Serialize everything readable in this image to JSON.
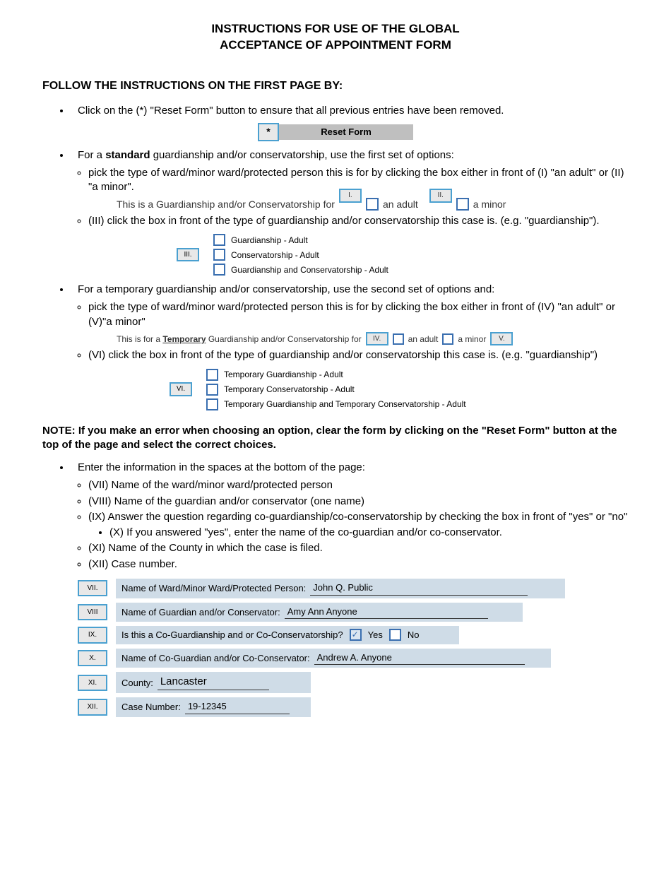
{
  "title_line1": "INSTRUCTIONS FOR USE OF THE GLOBAL",
  "title_line2": "ACCEPTANCE OF APPOINTMENT FORM",
  "section_head": "FOLLOW THE INSTRUCTIONS ON THE FIRST PAGE BY:",
  "bullet_reset": "Click on the (*) \"Reset Form\" button to ensure that all previous entries have been removed.",
  "reset_star": "*",
  "reset_label": "Reset Form",
  "bullet_standard_lead": "For a ",
  "bullet_standard_bold": "standard",
  "bullet_standard_tail": " guardianship and/or conservatorship, use the first set of options:",
  "sub_pick_standard": "pick the type of ward/minor ward/protected person this is for by clicking the box either in front of (I) \"an adult\" or (II) \"a minor\".",
  "line_standard_prefix": "This is a Guardianship and/or Conservatorship for",
  "label_adult": "an adult",
  "label_minor": "a minor",
  "callout_I": "I.",
  "callout_II": "II.",
  "sub_III": "(III) click the box in front of the type of guardianship and/or conservatorship this case is. (e.g. \"guardianship\").",
  "callout_III": "III.",
  "opt_g_adult": "Guardianship - Adult",
  "opt_c_adult": "Conservatorship - Adult",
  "opt_gc_adult": "Guardianship and Conservatorship - Adult",
  "bullet_temp": "For a temporary guardianship and/or conservatorship, use the second set of options and:",
  "sub_pick_temp": "pick the type of ward/minor ward/protected person this is for by clicking the box either in front of (IV) \"an adult\" or (V)\"a minor\"",
  "line_temp_prefix": "This is for a ",
  "line_temp_word": "Temporary",
  "line_temp_suffix": " Guardianship and/or Conservatorship for",
  "callout_IV": "IV.",
  "callout_V": "V.",
  "sub_VI": "(VI) click the box in front of the type of guardianship and/or conservatorship this case is. (e.g. \"guardianship\")",
  "callout_VI": "VI.",
  "opt_tg_adult": "Temporary Guardianship - Adult",
  "opt_tc_adult": "Temporary Conservatorship - Adult",
  "opt_tgc_adult": "Temporary Guardianship and Temporary Conservatorship - Adult",
  "note_text": "NOTE:  If you make an error when choosing an option, clear the form by clicking on the \"Reset Form\" button at the top of the page and select the correct choices.",
  "bullet_enter": "Enter the information in the spaces at the bottom of the page:",
  "sub_VII": "(VII) Name of the ward/minor ward/protected person",
  "sub_VIII": "(VIII) Name of the guardian and/or conservator (one name)",
  "sub_IX": "(IX) Answer the question regarding co-guardianship/co-conservatorship by checking the box in front of \"yes\" or \"no\"",
  "sub_X": "(X) If you answered \"yes\", enter the name of the co-guardian and/or co-conservator.",
  "sub_XI": "(XI) Name of the County in which the case is filed.",
  "sub_XII": "(XII) Case number.",
  "fields": {
    "VII": {
      "num": "VII.",
      "label": "Name of Ward/Minor Ward/Protected Person:",
      "value": "John Q. Public"
    },
    "VIII": {
      "num": "VIII",
      "label": "Name of Guardian and/or Conservator:",
      "value": "Amy Ann Anyone"
    },
    "IX": {
      "num": "IX.",
      "label": "Is this a Co-Guardianship and or Co-Conservatorship?",
      "yes": "Yes",
      "no": "No"
    },
    "X": {
      "num": "X.",
      "label": "Name of Co-Guardian and/or Co-Conservator:",
      "value": "Andrew A. Anyone"
    },
    "XI": {
      "num": "XI.",
      "label": "County:",
      "value": "Lancaster"
    },
    "XII": {
      "num": "XII.",
      "label": "Case Number:",
      "value": "19-12345"
    }
  }
}
